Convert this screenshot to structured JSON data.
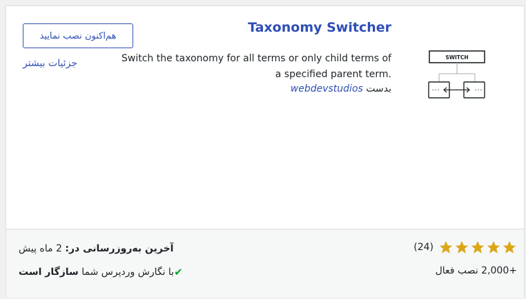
{
  "plugin": {
    "title": "Taxonomy Switcher",
    "description_line1": "Switch the taxonomy for all terms or only child terms of",
    "description_line2": ".a specified parent term",
    "author_prefix": "بدست",
    "author_name": "webdevstudios",
    "icon_label": "SWITCH"
  },
  "actions": {
    "install_label": "هم‌اکنون نصب نمایید",
    "details_label": "جزئیات بیشتر"
  },
  "stats": {
    "rating": 5,
    "rating_max": 5,
    "rating_count": "(24)",
    "active_installs": "+2,000 نصب فعال",
    "last_updated_label": "آخرین به‌روزرسانی در:",
    "last_updated_value": "2 ماه پیش",
    "compat_prefix": "با نگارش وردپرس شما",
    "compat_status": "سازگار است"
  },
  "colors": {
    "accent": "#2f4fb5",
    "star": "#dba617",
    "check": "#00a32a"
  }
}
